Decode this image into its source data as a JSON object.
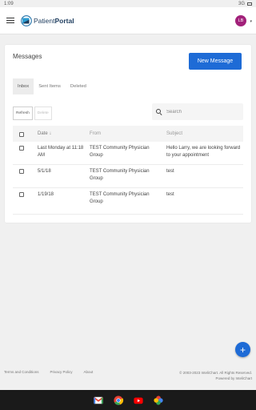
{
  "status": {
    "time": "1:09",
    "network": "3G"
  },
  "header": {
    "logo_text_normal": "Patient",
    "logo_text_bold": "Portal",
    "avatar_initials": "LB"
  },
  "messages": {
    "title": "Messages",
    "new_button": "New Message",
    "tabs": [
      {
        "label": "Inbox",
        "active": true
      },
      {
        "label": "Sent Items",
        "active": false
      },
      {
        "label": "Deleted",
        "active": false
      }
    ],
    "refresh_label": "Refresh",
    "delete_label": "Delete",
    "search_placeholder": "Search",
    "columns": {
      "date": "Date ↓",
      "from": "From",
      "subject": "Subject"
    },
    "rows": [
      {
        "date": "Last Monday at 11:18 AM",
        "from": "TEST Community Physician Group",
        "subject": "Hello Larry, we are looking forward to your appointment"
      },
      {
        "date": "5/1/18",
        "from": "TEST Community Physician Group",
        "subject": "test"
      },
      {
        "date": "1/19/18",
        "from": "TEST Community Physician Group",
        "subject": "test"
      }
    ]
  },
  "footer": {
    "terms": "Terms and Conditions",
    "privacy": "Privacy Policy",
    "about": "About",
    "copyright": "© 2003-2023 InteliChart. All Rights Reserved.",
    "powered": "Powered by InteliChart"
  },
  "colors": {
    "accent": "#1e6bd6",
    "avatar": "#a2217a",
    "logo": "#1d3c5e"
  }
}
